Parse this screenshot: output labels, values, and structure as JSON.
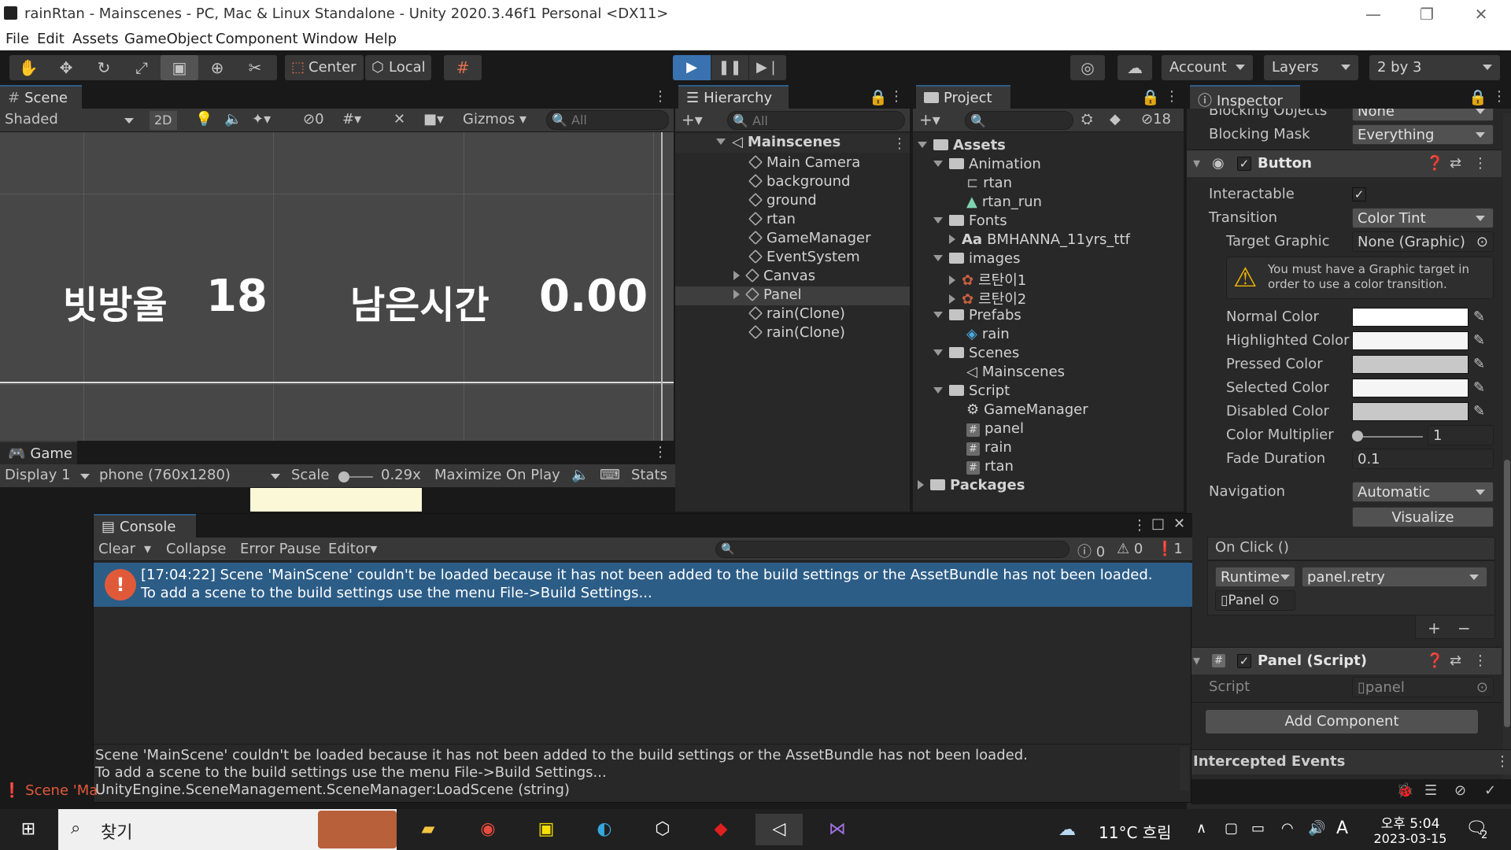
{
  "window": {
    "title": "rainRtan - Mainscenes - PC, Mac & Linux Standalone - Unity 2020.3.46f1 Personal <DX11>",
    "min": "—",
    "max": "❐",
    "close": "✕"
  },
  "menu": [
    "File",
    "Edit",
    "Assets",
    "GameObject",
    "Component",
    "Window",
    "Help"
  ],
  "toolbar": {
    "center": "Center",
    "local": "Local",
    "account": "Account",
    "layers": "Layers",
    "layout": "2 by 3"
  },
  "scene": {
    "tab": "Scene",
    "shading": "Shaded",
    "mode_2d": "2D",
    "hidden_count": "0",
    "gizmos": "Gizmos",
    "search_placeholder": "All",
    "ui_label1": "빗방울",
    "ui_value1": "18",
    "ui_label2": "남은시간",
    "ui_value2": "0.00"
  },
  "game": {
    "tab": "Game",
    "display": "Display 1",
    "resolution": "phone (760x1280)",
    "scale_label": "Scale",
    "scale_value": "0.29x",
    "maximize": "Maximize On Play",
    "stats": "Stats"
  },
  "hierarchy": {
    "tab": "Hierarchy",
    "search_placeholder": "All",
    "root": "Mainscenes",
    "items": [
      "Main Camera",
      "background",
      "ground",
      "rtan",
      "GameManager",
      "EventSystem",
      "Canvas",
      "Panel",
      "rain(Clone)",
      "rain(Clone)"
    ]
  },
  "project": {
    "tab": "Project",
    "hidden_count": "18",
    "root": "Assets",
    "animation": "Animation",
    "anim_rtan": "rtan",
    "anim_rtan_run": "rtan_run",
    "fonts": "Fonts",
    "font_aa": "Aa",
    "font_file": "BMHANNA_11yrs_ttf",
    "images": "images",
    "img1": "르탄이1",
    "img2": "르탄이2",
    "prefabs": "Prefabs",
    "prefab_rain": "rain",
    "scenes": "Scenes",
    "scene_main": "Mainscenes",
    "script": "Script",
    "s_gm": "GameManager",
    "s_panel": "panel",
    "s_rain": "rain",
    "s_rtan": "rtan",
    "packages": "Packages"
  },
  "inspector": {
    "tab": "Inspector",
    "blocking_objects": "Blocking Objects",
    "blocking_objects_val": "None",
    "blocking_mask": "Blocking Mask",
    "blocking_mask_val": "Everything",
    "button_comp": "Button",
    "interactable": "Interactable",
    "transition": "Transition",
    "transition_val": "Color Tint",
    "target_graphic": "Target Graphic",
    "target_graphic_val": "None (Graphic)",
    "warning": "You must have a Graphic target in order to use a color transition.",
    "normal": "Normal Color",
    "highlighted": "Highlighted Color",
    "pressed": "Pressed Color",
    "selected": "Selected Color",
    "disabled": "Disabled Color",
    "multiplier": "Color Multiplier",
    "multiplier_val": "1",
    "fade": "Fade Duration",
    "fade_val": "0.1",
    "navigation": "Navigation",
    "navigation_val": "Automatic",
    "visualize": "Visualize",
    "onclick": "On Click ()",
    "runtime": "Runtime",
    "function": "panel.retry",
    "object": "Panel",
    "plus": "+",
    "minus": "−",
    "panel_script": "Panel (Script)",
    "script_label": "Script",
    "script_val": "panel",
    "add_component": "Add Component",
    "intercepted": "Intercepted Events",
    "colors": {
      "normal": "#ffffff",
      "highlighted": "#f5f5f5",
      "pressed": "#c8c8c8",
      "selected": "#f5f5f5",
      "disabled": "#c8c8c8"
    }
  },
  "console": {
    "tab": "Console",
    "clear": "Clear",
    "collapse": "Collapse",
    "error_pause": "Error Pause",
    "editor": "Editor",
    "log_count": "0",
    "warn_count": "0",
    "err_count": "1",
    "entry_line1": "[17:04:22] Scene 'MainScene' couldn't be loaded because it has not been added to the build settings or the AssetBundle has not been loaded.",
    "entry_line2": "To add a scene to the build settings use the menu File->Build Settings...",
    "detail_line1": "Scene 'MainScene' couldn't be loaded because it has not been added to the build settings or the AssetBundle has not been loaded.",
    "detail_line2": "To add a scene to the build settings use the menu File->Build Settings...",
    "detail_line3": "UnityEngine.SceneManagement.SceneManager:LoadScene (string)"
  },
  "statusbar": {
    "text": "Scene 'Ma"
  },
  "taskbar": {
    "search": "찾기",
    "weather": "11°C 흐림",
    "ime": "A",
    "ampm_time": "오후 5:04",
    "date": "2023-03-15",
    "notif": "2"
  }
}
